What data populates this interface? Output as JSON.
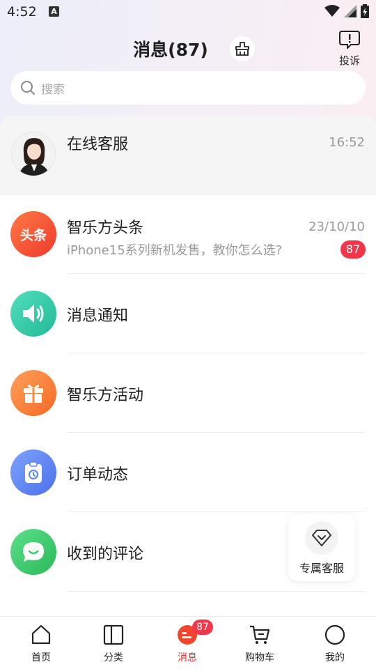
{
  "status": {
    "time": "4:52",
    "badge": "A"
  },
  "header": {
    "title": "消息(87)",
    "complain_label": "投诉"
  },
  "search": {
    "placeholder": "搜索"
  },
  "pinned": {
    "title": "在线客服",
    "time": "16:52"
  },
  "messages": [
    {
      "title": "智乐方头条",
      "subtitle": "iPhone15系列新机发售，教你怎么选?",
      "time": "23/10/10",
      "badge": "87",
      "icon": "headline-icon",
      "icon_text": "头条",
      "color": "#f0552e"
    },
    {
      "title": "消息通知",
      "icon": "speaker-icon",
      "color": "#2fc8a4"
    },
    {
      "title": "智乐方活动",
      "icon": "gift-icon",
      "color": "#fb7c2f"
    },
    {
      "title": "订单动态",
      "icon": "clipboard-clock-icon",
      "color": "#5b86f4"
    },
    {
      "title": "收到的评论",
      "icon": "chat-bubble-icon",
      "color": "#38c86a"
    }
  ],
  "float_service": {
    "label": "专属客服",
    "icon": "diamond-icon"
  },
  "bottom_nav": [
    {
      "label": "首页",
      "icon": "home-icon"
    },
    {
      "label": "分类",
      "icon": "category-icon"
    },
    {
      "label": "消息",
      "icon": "message-icon",
      "badge": "87",
      "active": true
    },
    {
      "label": "购物车",
      "icon": "cart-icon"
    },
    {
      "label": "我的",
      "icon": "profile-icon"
    }
  ],
  "colors": {
    "accent": "#e8322e",
    "badge": "#f3364a"
  }
}
